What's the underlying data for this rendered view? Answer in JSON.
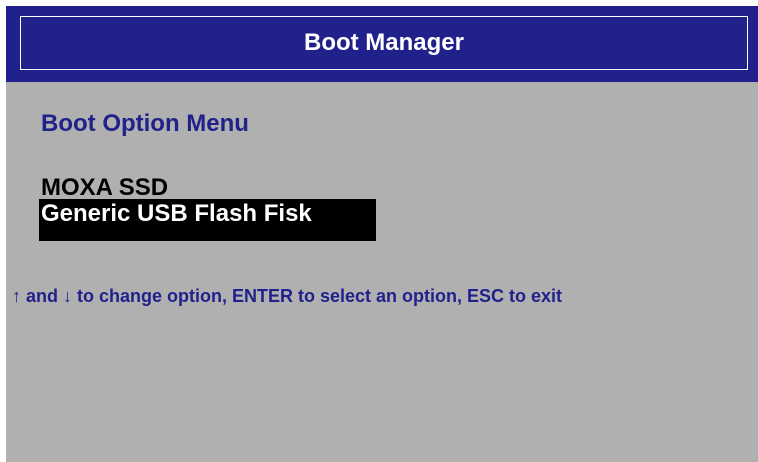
{
  "header": {
    "title": "Boot Manager"
  },
  "menu": {
    "title": "Boot Option Menu",
    "options": [
      {
        "label": "MOXA SSD",
        "selected": false
      },
      {
        "label": "Generic USB Flash Fisk",
        "selected": true
      }
    ]
  },
  "help": {
    "text": "↑ and ↓ to change option, ENTER to select an option, ESC to exit"
  },
  "colors": {
    "header_background": "#21218c",
    "screen_background": "#b0b0b0",
    "heading_text": "#21218c",
    "selection_background": "#000000",
    "selection_text": "#ffffff"
  }
}
